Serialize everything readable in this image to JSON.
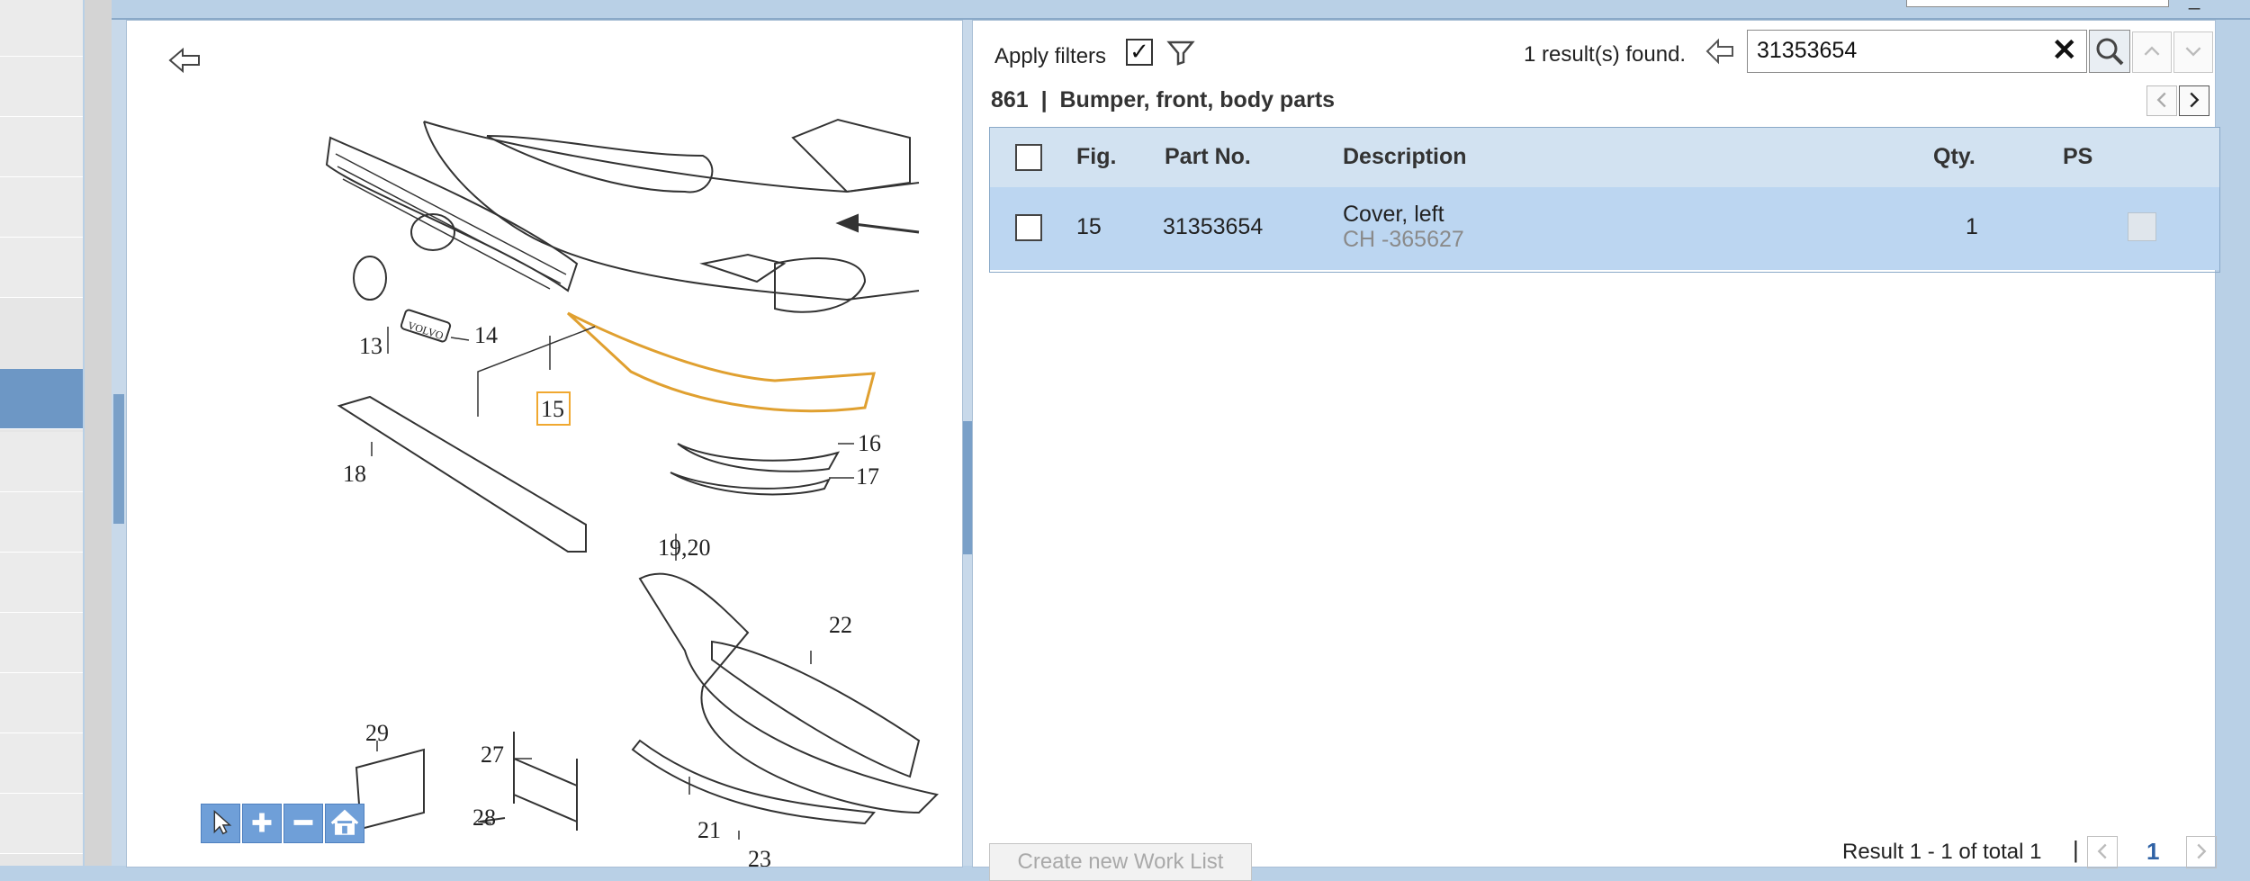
{
  "topbar": {
    "minimize_symbol": "_"
  },
  "diagram": {
    "labels": {
      "l13": "13",
      "l14": "14",
      "l15": "15",
      "l16": "16",
      "l17": "17",
      "l18": "18",
      "l1920": "19,20",
      "l21": "21",
      "l22": "22",
      "l23": "23",
      "l27": "27",
      "l28": "28",
      "l29": "29",
      "badge": "VOLVO"
    },
    "tools": [
      "pointer-icon",
      "zoom-in-icon",
      "zoom-out-icon",
      "home-icon"
    ]
  },
  "filters": {
    "apply_label": "Apply filters",
    "checked_mark": "✓"
  },
  "search": {
    "results_count": "1 result(s) found.",
    "query": "31353654",
    "clear_symbol": "✕"
  },
  "group": {
    "title": "861  |  Bumper, front, body parts"
  },
  "table": {
    "headers": {
      "fig": "Fig.",
      "part_no": "Part No.",
      "description": "Description",
      "qty": "Qty.",
      "ps": "PS"
    },
    "rows": [
      {
        "fig": "15",
        "part_no": "31353654",
        "description": "Cover, left",
        "sub": "CH -365627",
        "qty": "1"
      }
    ]
  },
  "footer": {
    "create_worklist": "Create new Work List",
    "result_range": "Result 1 - 1 of total 1",
    "separator": "|",
    "current_page": "1"
  },
  "colors": {
    "accent": "#6f9fd8",
    "row_selected": "#bcd6f1",
    "header_bg": "#d2e2f1",
    "highlight": "#f0a830"
  }
}
